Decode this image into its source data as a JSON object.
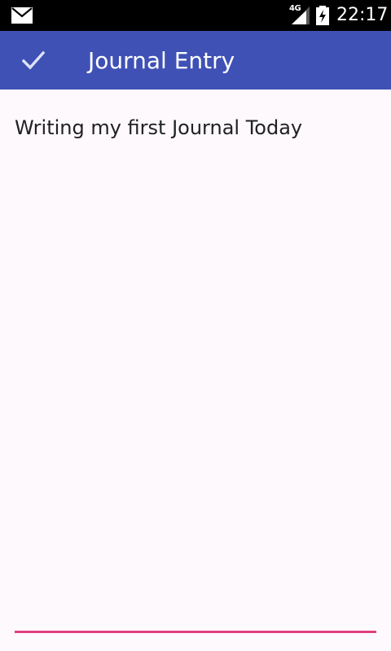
{
  "status_bar": {
    "network_type": "4G",
    "time": "22:17",
    "icons": [
      "mail-icon",
      "signal-icon",
      "battery-charging-icon"
    ]
  },
  "app_bar": {
    "done_icon": "check-icon",
    "title": "Journal Entry",
    "color": "#3f51b5"
  },
  "entry": {
    "value": "Writing my first Journal Today",
    "underline_color": "#e04080"
  }
}
